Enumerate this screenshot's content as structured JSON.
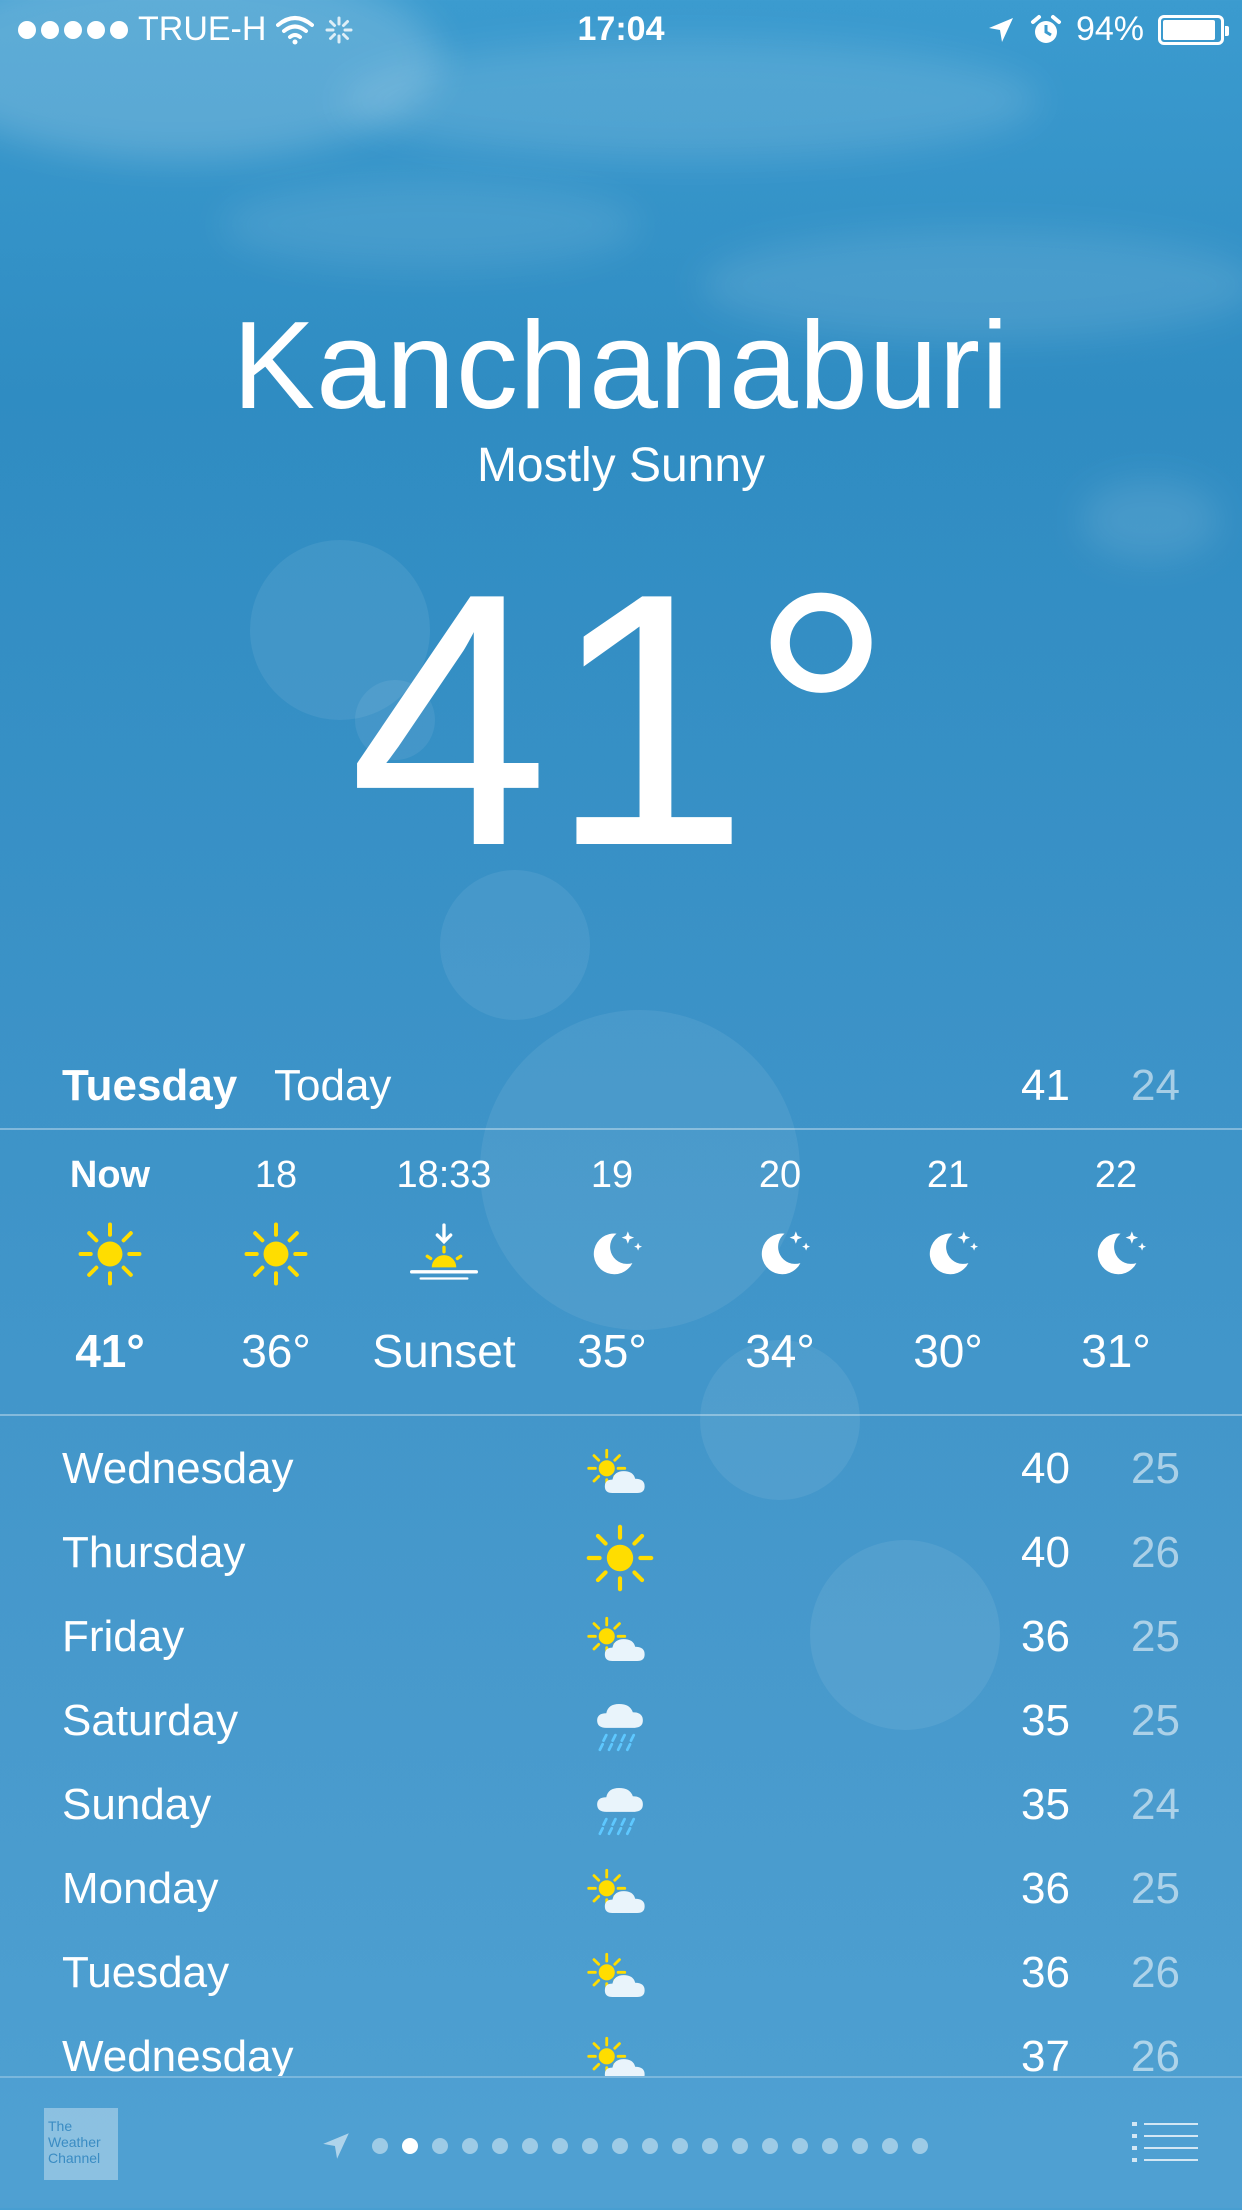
{
  "status_bar": {
    "carrier": "TRUE-H",
    "time": "17:04",
    "battery": "94%",
    "battery_level": 0.94
  },
  "location": {
    "city": "Kanchanaburi",
    "condition": "Mostly Sunny",
    "temperature": "41°"
  },
  "today": {
    "day": "Tuesday",
    "label": "Today",
    "high": "41",
    "low": "24"
  },
  "hourly": [
    {
      "time": "Now",
      "icon": "sun-icon",
      "temp": "41°"
    },
    {
      "time": "18",
      "icon": "sun-icon",
      "temp": "36°"
    },
    {
      "time": "18:33",
      "icon": "sunset-icon",
      "temp": "Sunset"
    },
    {
      "time": "19",
      "icon": "moon-icon",
      "temp": "35°"
    },
    {
      "time": "20",
      "icon": "moon-icon",
      "temp": "34°"
    },
    {
      "time": "21",
      "icon": "moon-icon",
      "temp": "30°"
    },
    {
      "time": "22",
      "icon": "moon-icon",
      "temp": "31°"
    }
  ],
  "daily": [
    {
      "day": "Wednesday",
      "icon": "partly-cloudy-icon",
      "high": "40",
      "low": "25"
    },
    {
      "day": "Thursday",
      "icon": "sun-icon",
      "high": "40",
      "low": "26"
    },
    {
      "day": "Friday",
      "icon": "partly-cloudy-icon",
      "high": "36",
      "low": "25"
    },
    {
      "day": "Saturday",
      "icon": "rain-icon",
      "high": "35",
      "low": "25"
    },
    {
      "day": "Sunday",
      "icon": "rain-icon",
      "high": "35",
      "low": "24"
    },
    {
      "day": "Monday",
      "icon": "partly-cloudy-icon",
      "high": "36",
      "low": "25"
    },
    {
      "day": "Tuesday",
      "icon": "partly-cloudy-icon",
      "high": "36",
      "low": "26"
    },
    {
      "day": "Wednesday",
      "icon": "partly-cloudy-icon",
      "high": "37",
      "low": "26"
    }
  ],
  "footer": {
    "logo_text": "The Weather Channel",
    "page_count": 19,
    "active_page": 1
  },
  "colors": {
    "sun": "#ffdd00",
    "rain": "#5ec8ff",
    "low_temp": "rgba(255,255,255,0.55)"
  }
}
